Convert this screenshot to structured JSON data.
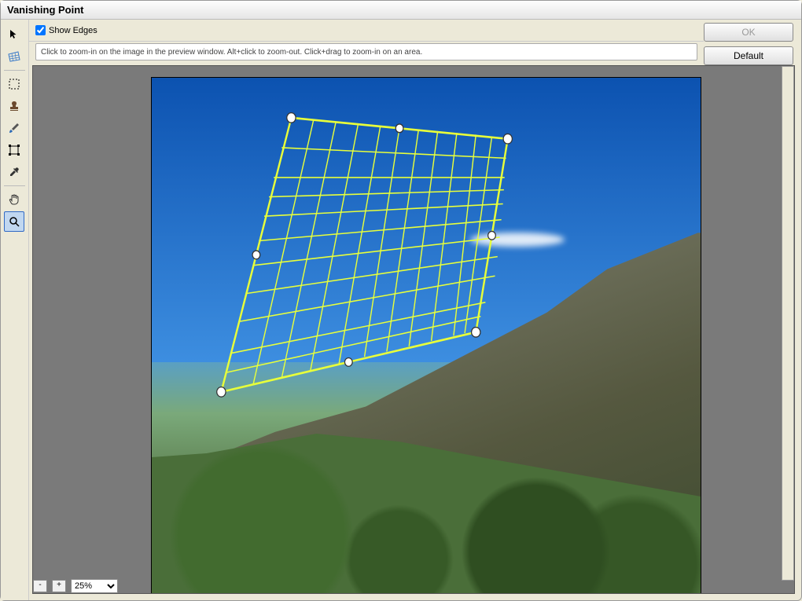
{
  "window": {
    "title": "Vanishing Point"
  },
  "options": {
    "show_edges_label": "Show Edges",
    "show_edges_checked": true
  },
  "statusbar": {
    "hint": "Click to zoom-in on the image in the preview window. Alt+click to zoom-out. Click+drag to zoom-in on an area."
  },
  "buttons": {
    "ok": "OK",
    "default": "Default"
  },
  "zoom": {
    "minus": "-",
    "plus": "+",
    "value": "25%"
  },
  "tools": {
    "arrow": "arrow",
    "create_plane": "create-plane",
    "marquee": "marquee",
    "stamp": "stamp",
    "brush": "brush",
    "transform": "transform",
    "eyedropper": "eyedropper",
    "hand": "hand",
    "zoom": "zoom"
  }
}
